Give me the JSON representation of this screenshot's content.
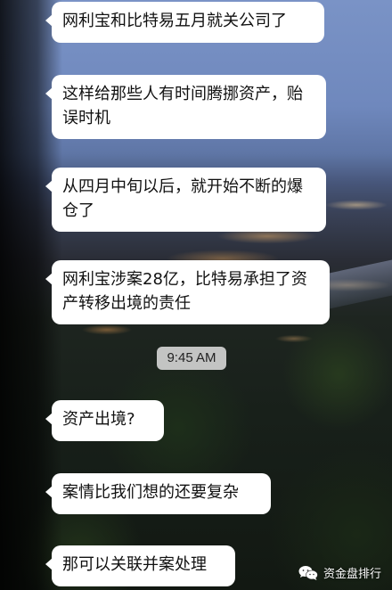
{
  "messages": [
    {
      "text": "网利宝和比特易五月就关公司了"
    },
    {
      "text": "这样给那些人有时间腾挪资产，贻误时机"
    },
    {
      "text": "从四月中旬以后，就开始不断的爆仓了"
    },
    {
      "text": "网利宝涉案28亿，比特易承担了资产转移出境的责任"
    },
    {
      "text": "资产出境?"
    },
    {
      "text": "案情比我们想的还要复杂"
    },
    {
      "text": "那可以关联并案处理"
    }
  ],
  "timestamp": "9:45 AM",
  "watermark": {
    "icon": "wechat-icon",
    "text": "资金盘排行"
  },
  "colors": {
    "bubble": "#ffffff",
    "timestamp_bg": "#e1e1e1",
    "text": "#111111"
  }
}
